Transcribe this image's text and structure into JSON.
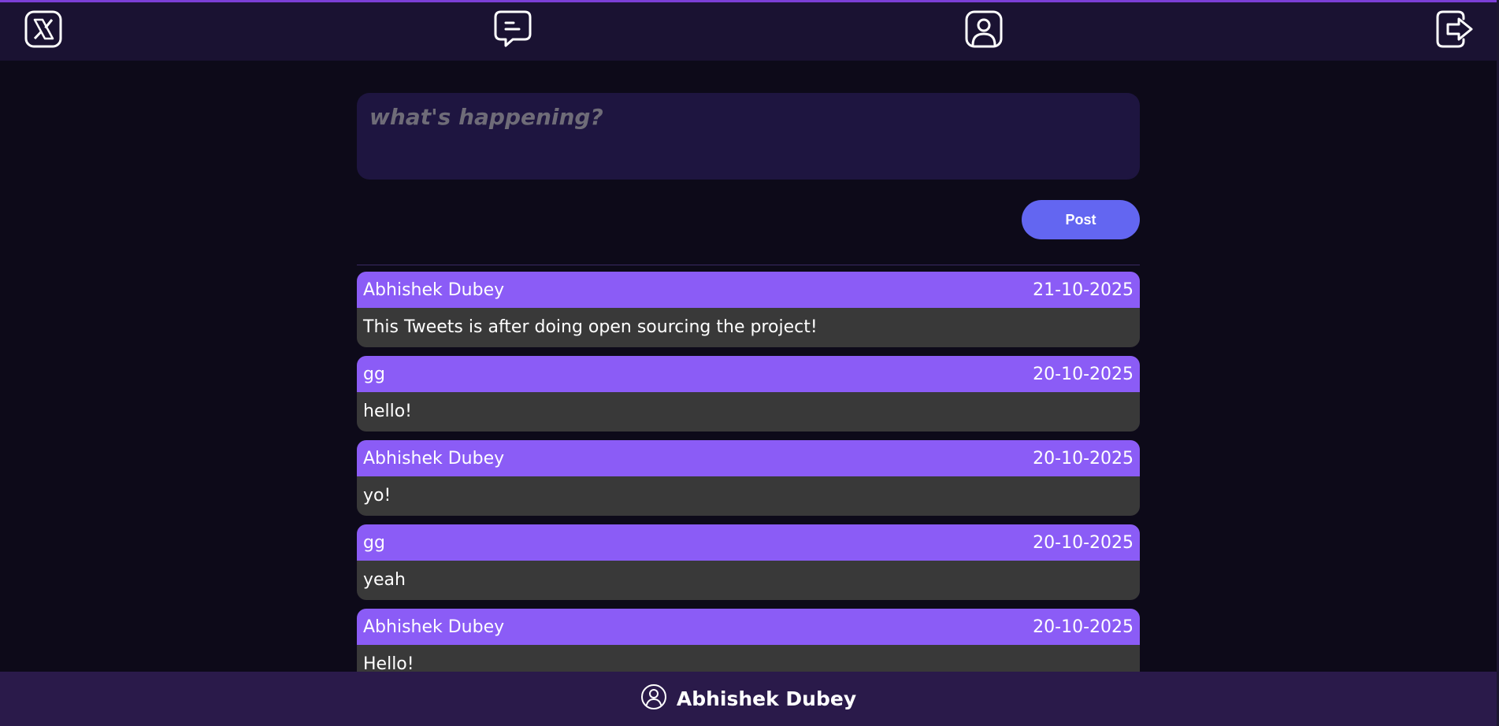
{
  "nav": {
    "icons": [
      "x-logo-icon",
      "message-icon",
      "profile-icon",
      "logout-icon"
    ]
  },
  "composer": {
    "placeholder": "what's happening?",
    "post_label": "Post"
  },
  "tweets": [
    {
      "author": "Abhishek Dubey",
      "date": "21-10-2025",
      "text": "This Tweets is after doing open sourcing the project!"
    },
    {
      "author": "gg",
      "date": "20-10-2025",
      "text": "hello!"
    },
    {
      "author": "Abhishek Dubey",
      "date": "20-10-2025",
      "text": "yo!"
    },
    {
      "author": "gg",
      "date": "20-10-2025",
      "text": "yeah"
    },
    {
      "author": "Abhishek Dubey",
      "date": "20-10-2025",
      "text": "Hello!"
    }
  ],
  "footer": {
    "username": "Abhishek Dubey"
  },
  "colors": {
    "background": "#0d0a19",
    "topbar": "#1a1232",
    "accent": "#8b5cf6",
    "button": "#6366f1",
    "card_body": "#393939",
    "footer": "#2a1a4a"
  }
}
